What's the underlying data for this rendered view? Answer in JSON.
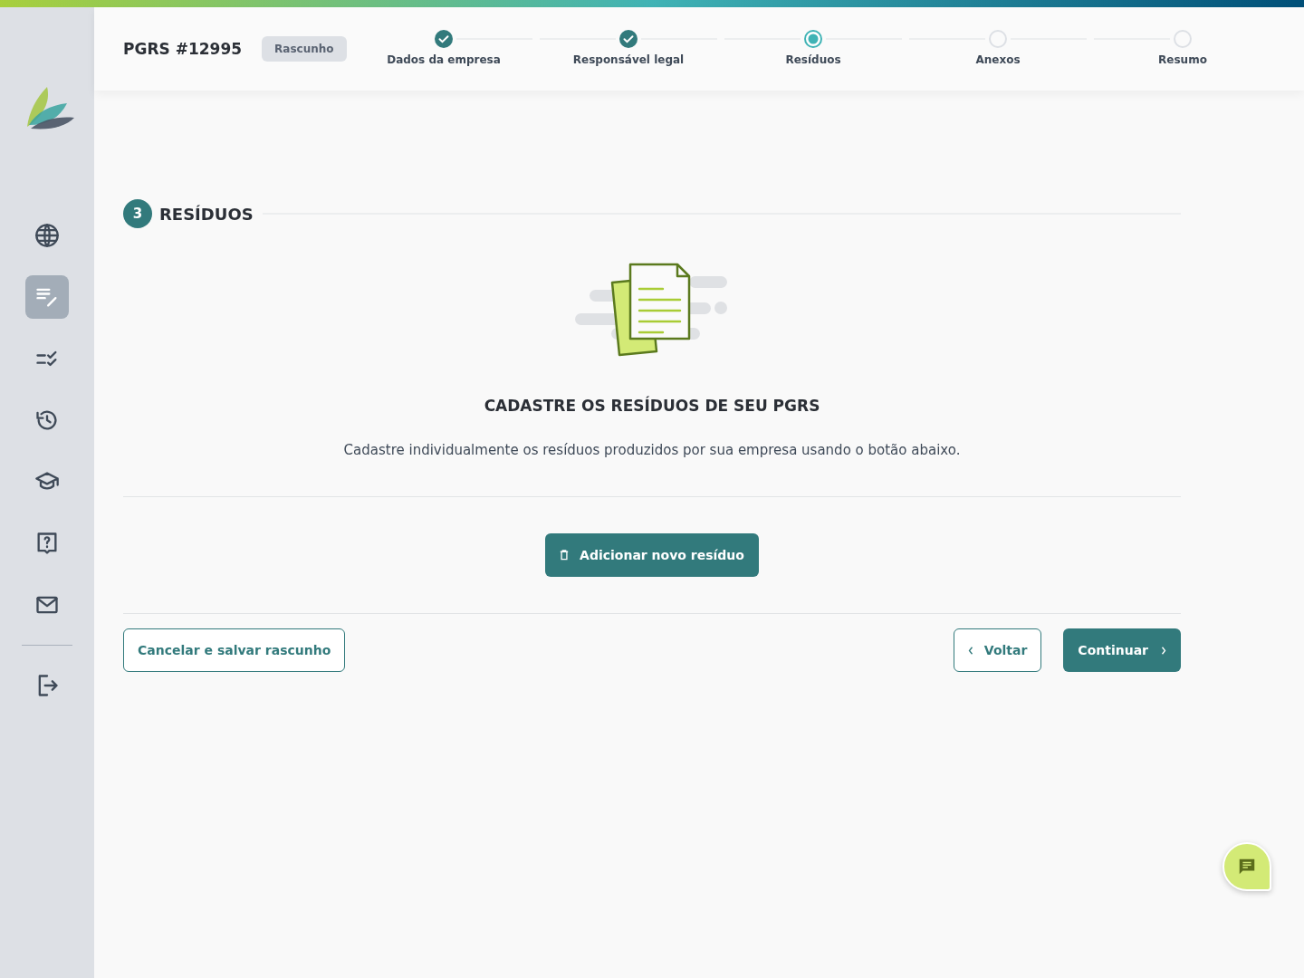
{
  "sidebar": {
    "items": [
      {
        "kind": "globe",
        "selected": false
      },
      {
        "kind": "edit-list",
        "selected": true
      },
      {
        "kind": "checklist",
        "selected": false
      },
      {
        "kind": "history",
        "selected": false
      },
      {
        "kind": "cap",
        "selected": false
      },
      {
        "kind": "help",
        "selected": false
      },
      {
        "kind": "mail",
        "selected": false
      }
    ],
    "footer_items": [
      {
        "kind": "logout",
        "selected": false
      }
    ]
  },
  "header": {
    "title": "PGRS #12995",
    "badge": "Rascunho",
    "steps": [
      {
        "label": "Dados da empresa",
        "completed": true,
        "selected": false
      },
      {
        "label": "Responsável legal",
        "completed": true,
        "selected": false
      },
      {
        "label": "Resíduos",
        "completed": false,
        "selected": true
      },
      {
        "label": "Anexos",
        "completed": false,
        "selected": false
      },
      {
        "label": "Resumo",
        "completed": false,
        "selected": false
      }
    ]
  },
  "section": {
    "number": "3",
    "title": "RESÍDUOS"
  },
  "empty_state": {
    "title": "CADASTRE OS RESÍDUOS DE SEU PGRS",
    "description": "Cadastre individualmente os resíduos produzidos por sua empresa usando o botão abaixo.",
    "button": "Adicionar novo resíduo"
  },
  "footer": {
    "cancel": "Cancelar e salvar rascunho",
    "back": "Voltar",
    "next": "Continuar"
  }
}
